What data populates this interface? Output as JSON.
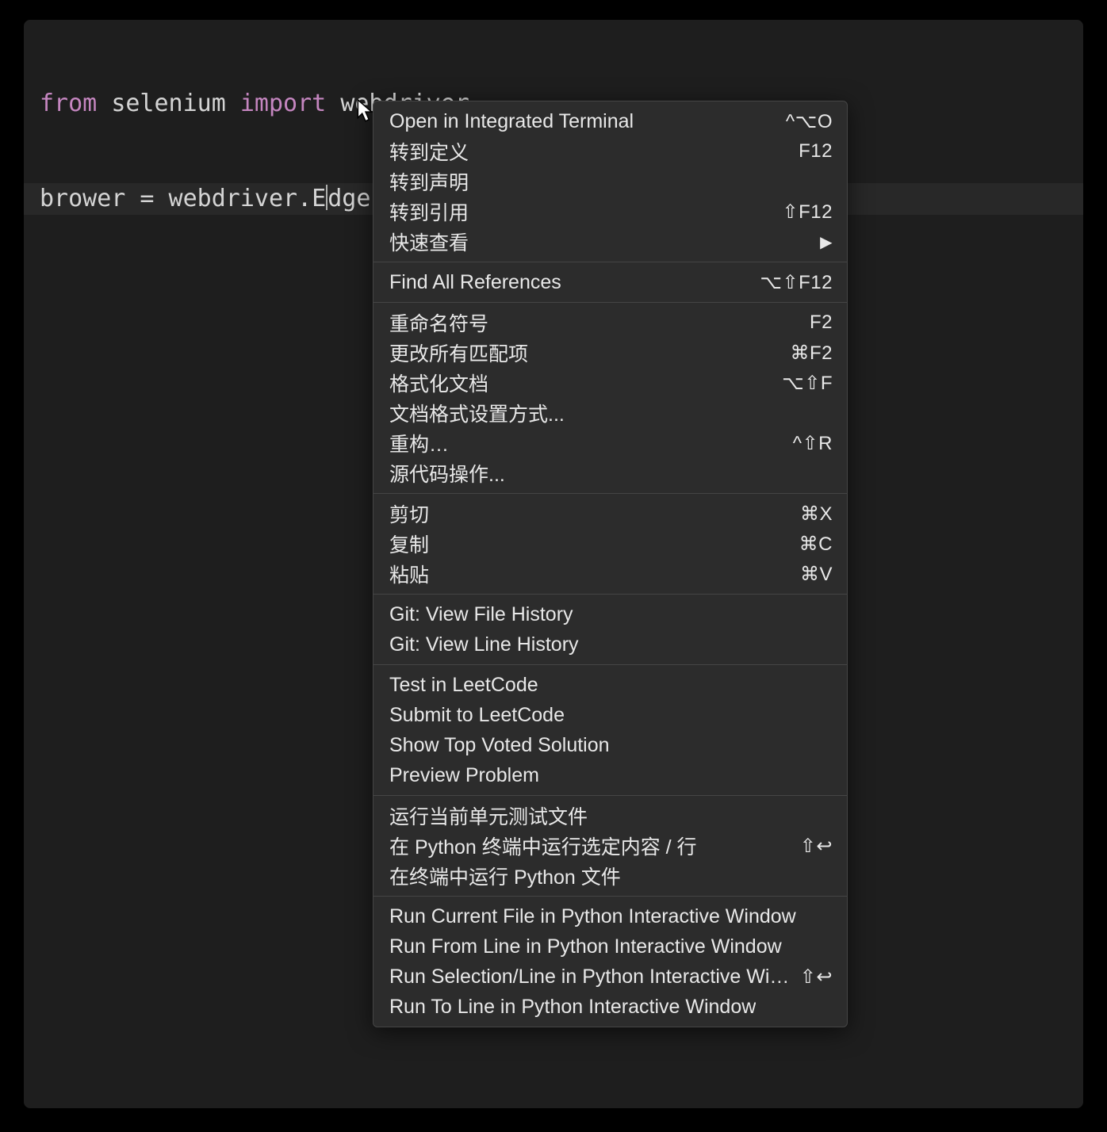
{
  "code": {
    "line1": {
      "kw_from": "from",
      "mod": "selenium",
      "kw_import": "import",
      "name": "webdriver"
    },
    "line2": {
      "text": "brower = webdriver.Edge()"
    }
  },
  "menu_groups": [
    [
      {
        "label": "Open in Integrated Terminal",
        "shortcut": "^⌥O"
      },
      {
        "label": "转到定义",
        "shortcut": "F12"
      },
      {
        "label": "转到声明",
        "shortcut": ""
      },
      {
        "label": "转到引用",
        "shortcut": "⇧F12"
      },
      {
        "label": "快速查看",
        "shortcut": "",
        "submenu": true
      }
    ],
    [
      {
        "label": "Find All References",
        "shortcut": "⌥⇧F12"
      }
    ],
    [
      {
        "label": "重命名符号",
        "shortcut": "F2"
      },
      {
        "label": "更改所有匹配项",
        "shortcut": "⌘F2"
      },
      {
        "label": "格式化文档",
        "shortcut": "⌥⇧F"
      },
      {
        "label": "文档格式设置方式...",
        "shortcut": ""
      },
      {
        "label": "重构…",
        "shortcut": "^⇧R"
      },
      {
        "label": "源代码操作...",
        "shortcut": ""
      }
    ],
    [
      {
        "label": "剪切",
        "shortcut": "⌘X"
      },
      {
        "label": "复制",
        "shortcut": "⌘C"
      },
      {
        "label": "粘贴",
        "shortcut": "⌘V"
      }
    ],
    [
      {
        "label": "Git: View File History",
        "shortcut": ""
      },
      {
        "label": "Git: View Line History",
        "shortcut": ""
      }
    ],
    [
      {
        "label": "Test in LeetCode",
        "shortcut": ""
      },
      {
        "label": "Submit to LeetCode",
        "shortcut": ""
      },
      {
        "label": "Show Top Voted Solution",
        "shortcut": ""
      },
      {
        "label": "Preview Problem",
        "shortcut": ""
      }
    ],
    [
      {
        "label": "运行当前单元测试文件",
        "shortcut": ""
      },
      {
        "label": "在 Python 终端中运行选定内容 / 行",
        "shortcut": "⇧↩"
      },
      {
        "label": "在终端中运行 Python 文件",
        "shortcut": ""
      }
    ],
    [
      {
        "label": "Run Current File in Python Interactive Window",
        "shortcut": ""
      },
      {
        "label": "Run From Line in Python Interactive Window",
        "shortcut": ""
      },
      {
        "label": "Run Selection/Line in Python Interactive Window",
        "shortcut": "⇧↩"
      },
      {
        "label": "Run To Line in Python Interactive Window",
        "shortcut": ""
      }
    ]
  ]
}
